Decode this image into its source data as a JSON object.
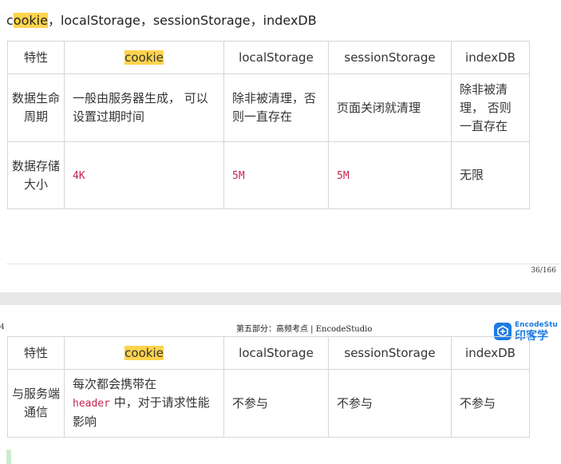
{
  "heading": {
    "pre": "c",
    "hl": "ookie",
    "rest": "，localStorage，sessionStorage，indexDB"
  },
  "columns": {
    "feature": "特性",
    "cookie": "cookie",
    "localStorage": "localStorage",
    "sessionStorage": "sessionStorage",
    "indexDB": "indexDB"
  },
  "rows": [
    {
      "feature": "数据生命周期",
      "cookie": "一般由服务器生成， 可以设置过期时间",
      "localStorage": "除非被清理，否则一直存在",
      "sessionStorage": "页面关闭就清理",
      "indexDB": "除非被清理， 否则一直存在"
    },
    {
      "feature": "数据存储大小",
      "cookie": "4K",
      "localStorage": "5M",
      "sessionStorage": "5M",
      "indexDB": "无限"
    },
    {
      "feature": "与服务端通信",
      "cookie_pre": "每次都会携带在",
      "cookie_code": "header",
      "cookie_post": " 中，对于请求性能影响",
      "localStorage": "不参与",
      "sessionStorage": "不参与",
      "indexDB": "不参与"
    }
  ],
  "page_number": "36/166",
  "left_page_number": "4",
  "running_header": "第五部分：高频考点 | EncodeStudio",
  "logo": {
    "en": "EncodeStu",
    "cn": "印客学",
    "icon": "encode-studio-logo-icon",
    "color": "#1e7be3"
  },
  "highlight_color": "#ffd34d",
  "code_color": "#c7254e"
}
